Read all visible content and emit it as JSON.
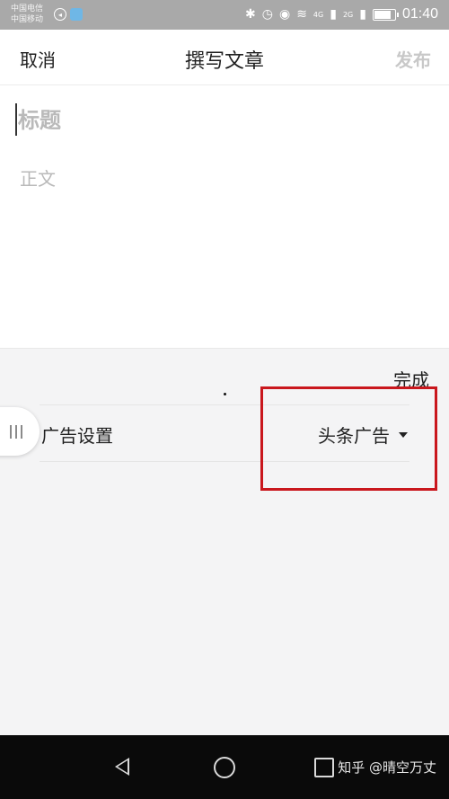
{
  "status_bar": {
    "carrier_1": "中国电信",
    "carrier_2": "中国移动",
    "network_1": "4G",
    "network_2": "2G",
    "time": "01:40",
    "battery_level": 0.85
  },
  "header": {
    "cancel_label": "取消",
    "title": "撰写文章",
    "publish_label": "发布"
  },
  "editor": {
    "title_placeholder": "标题",
    "body_placeholder": "正文"
  },
  "panel": {
    "done_label": "完成",
    "ad_setting_label": "广告设置",
    "ad_setting_value": "头条广告"
  },
  "watermark": "知乎 @晴空万丈",
  "colors": {
    "highlight": "#c9171d",
    "status_bar": "#a9a9a9",
    "nav_bar": "#0a0a0a"
  }
}
